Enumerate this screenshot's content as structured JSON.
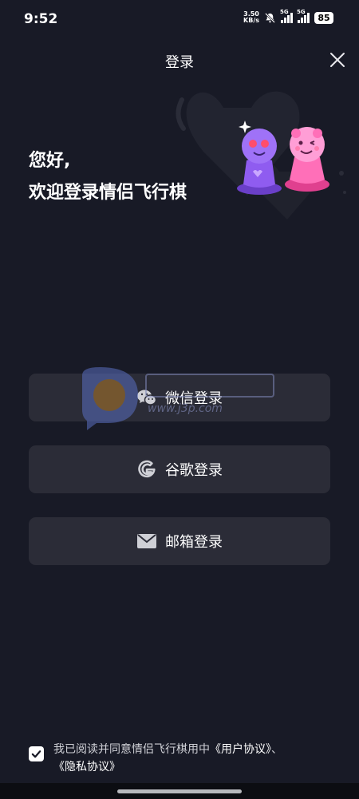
{
  "status_bar": {
    "time": "9:52",
    "net_speed_value": "3.50",
    "net_speed_unit": "KB/s",
    "signal_1": "5G",
    "signal_2": "5G",
    "battery": "85"
  },
  "header": {
    "title": "登录"
  },
  "greeting": {
    "line1": "您好,",
    "line2": "欢迎登录情侣飞行棋"
  },
  "login_buttons": {
    "wechat": "微信登录",
    "google": "谷歌登录",
    "email": "邮箱登录"
  },
  "watermark": {
    "url_text": "www.j3p.com"
  },
  "agreement": {
    "text": "我已阅读并同意情侣飞行棋用中",
    "user_agreement": "《用户协议》",
    "separator": "、",
    "privacy": "《隐私协议》",
    "checked": true
  },
  "colors": {
    "background": "#181a26",
    "button": "#2b2c37",
    "text": "#ffffff",
    "muted_text": "#cfd0d6"
  },
  "icons": [
    "close-icon",
    "wechat-icon",
    "google-icon",
    "mail-icon",
    "check-icon",
    "bell-off-icon"
  ]
}
